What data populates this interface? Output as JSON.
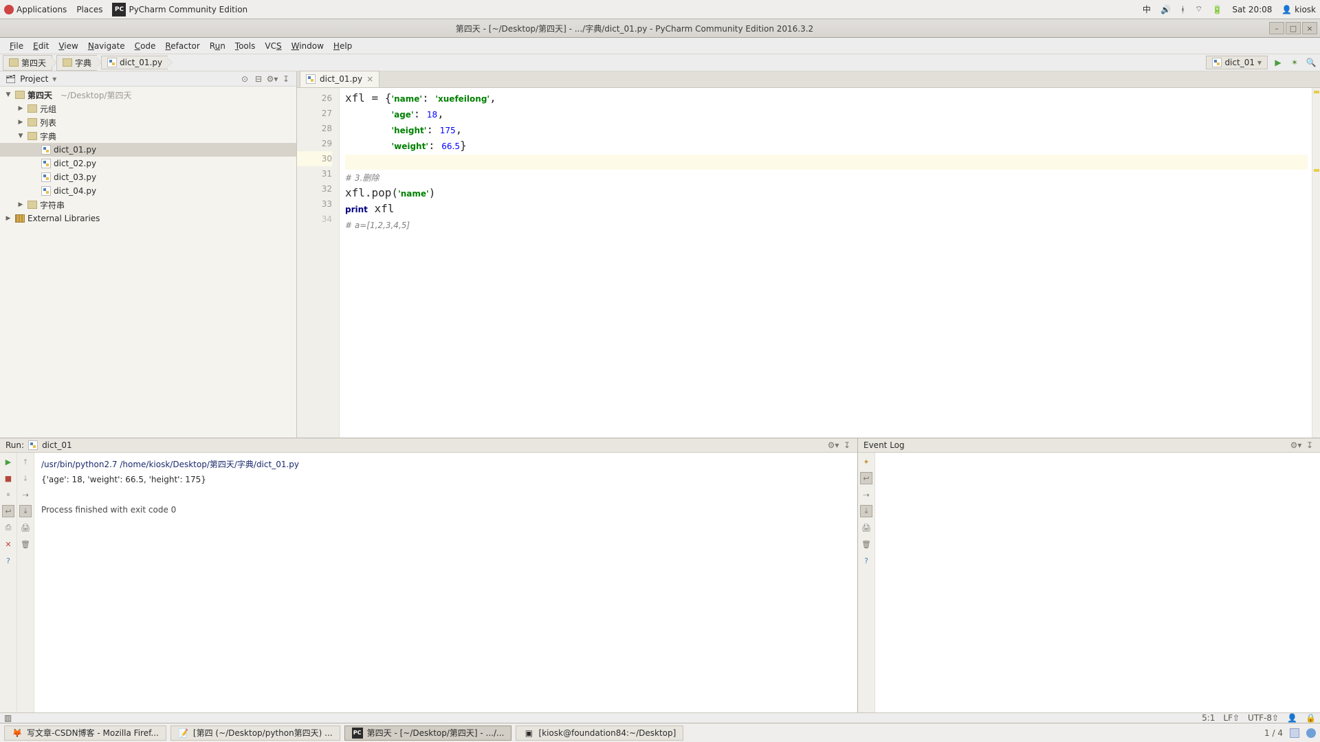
{
  "gnome": {
    "apps": "Applications",
    "places": "Places",
    "app_name": "PyCharm Community Edition",
    "ime": "中",
    "clock": "Sat 20:08",
    "user": "kiosk"
  },
  "window": {
    "title": "第四天 - [~/Desktop/第四天] - .../字典/dict_01.py - PyCharm Community Edition 2016.3.2"
  },
  "menu": [
    "File",
    "Edit",
    "View",
    "Navigate",
    "Code",
    "Refactor",
    "Run",
    "Tools",
    "VCS",
    "Window",
    "Help"
  ],
  "crumbs": [
    "第四天",
    "字典",
    "dict_01.py"
  ],
  "run_config": "dict_01",
  "project": {
    "label": "Project",
    "root": {
      "name": "第四天",
      "path": "~/Desktop/第四天"
    },
    "folders": [
      "元组",
      "列表",
      "字典"
    ],
    "files": [
      "dict_01.py",
      "dict_02.py",
      "dict_03.py",
      "dict_04.py"
    ],
    "folder_end": "字符串",
    "libs": "External Libraries"
  },
  "editor": {
    "tab": "dict_01.py",
    "lines": [
      26,
      27,
      28,
      29,
      30,
      31,
      32,
      33,
      34
    ]
  },
  "run": {
    "label": "Run:",
    "name": "dict_01",
    "cmd": "/usr/bin/python2.7 /home/kiosk/Desktop/第四天/字典/dict_01.py",
    "out": "{'age': 18, 'weight': 66.5, 'height': 175}",
    "fin": "Process finished with exit code 0"
  },
  "eventlog": "Event Log",
  "status": {
    "pos": "5:1",
    "le": "LF⇧",
    "enc": "UTF-8⇧"
  },
  "tasks": [
    "写文章-CSDN博客 - Mozilla Firef...",
    "[第四 (~/Desktop/python第四天) ...",
    "第四天 - [~/Desktop/第四天] - .../...",
    "[kiosk@foundation84:~/Desktop]"
  ],
  "tray": {
    "pages": "1 / 4"
  }
}
